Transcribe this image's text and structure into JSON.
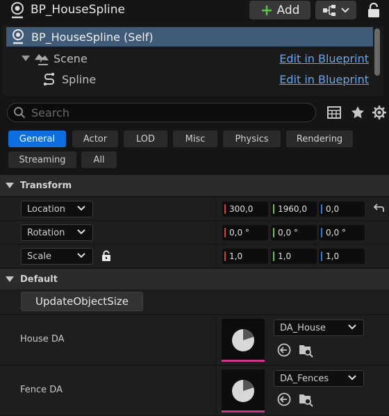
{
  "header": {
    "title": "BP_HouseSpline",
    "add_label": "Add"
  },
  "tree": {
    "items": [
      {
        "label": "BP_HouseSpline (Self)",
        "link": ""
      },
      {
        "label": "Scene",
        "link": "Edit in Blueprint"
      },
      {
        "label": "Spline",
        "link": "Edit in Blueprint"
      }
    ]
  },
  "search": {
    "placeholder": "Search"
  },
  "filter_tabs": [
    "General",
    "Actor",
    "LOD",
    "Misc",
    "Physics",
    "Rendering",
    "Streaming",
    "All"
  ],
  "active_tab": "General",
  "transform": {
    "section_label": "Transform",
    "location": {
      "label": "Location",
      "x": "300,0",
      "y": "1960,0",
      "z": "0,0"
    },
    "rotation": {
      "label": "Rotation",
      "x": "0,0 °",
      "y": "0,0 °",
      "z": "0,0 °"
    },
    "scale": {
      "label": "Scale",
      "x": "1,0",
      "y": "1,0",
      "z": "1,0"
    }
  },
  "default": {
    "section_label": "Default",
    "update_button": "UpdateObjectSize",
    "house": {
      "label": "House DA",
      "value": "DA_House"
    },
    "fence": {
      "label": "Fence DA",
      "value": "DA_Fences"
    }
  },
  "colors": {
    "accent": "#0e6ee0",
    "x_axis": "#e03c3c",
    "y_axis": "#7ac13e",
    "z_axis": "#2f7ce8",
    "asset_bar": "#d0338a",
    "link": "#6aa6ec"
  }
}
